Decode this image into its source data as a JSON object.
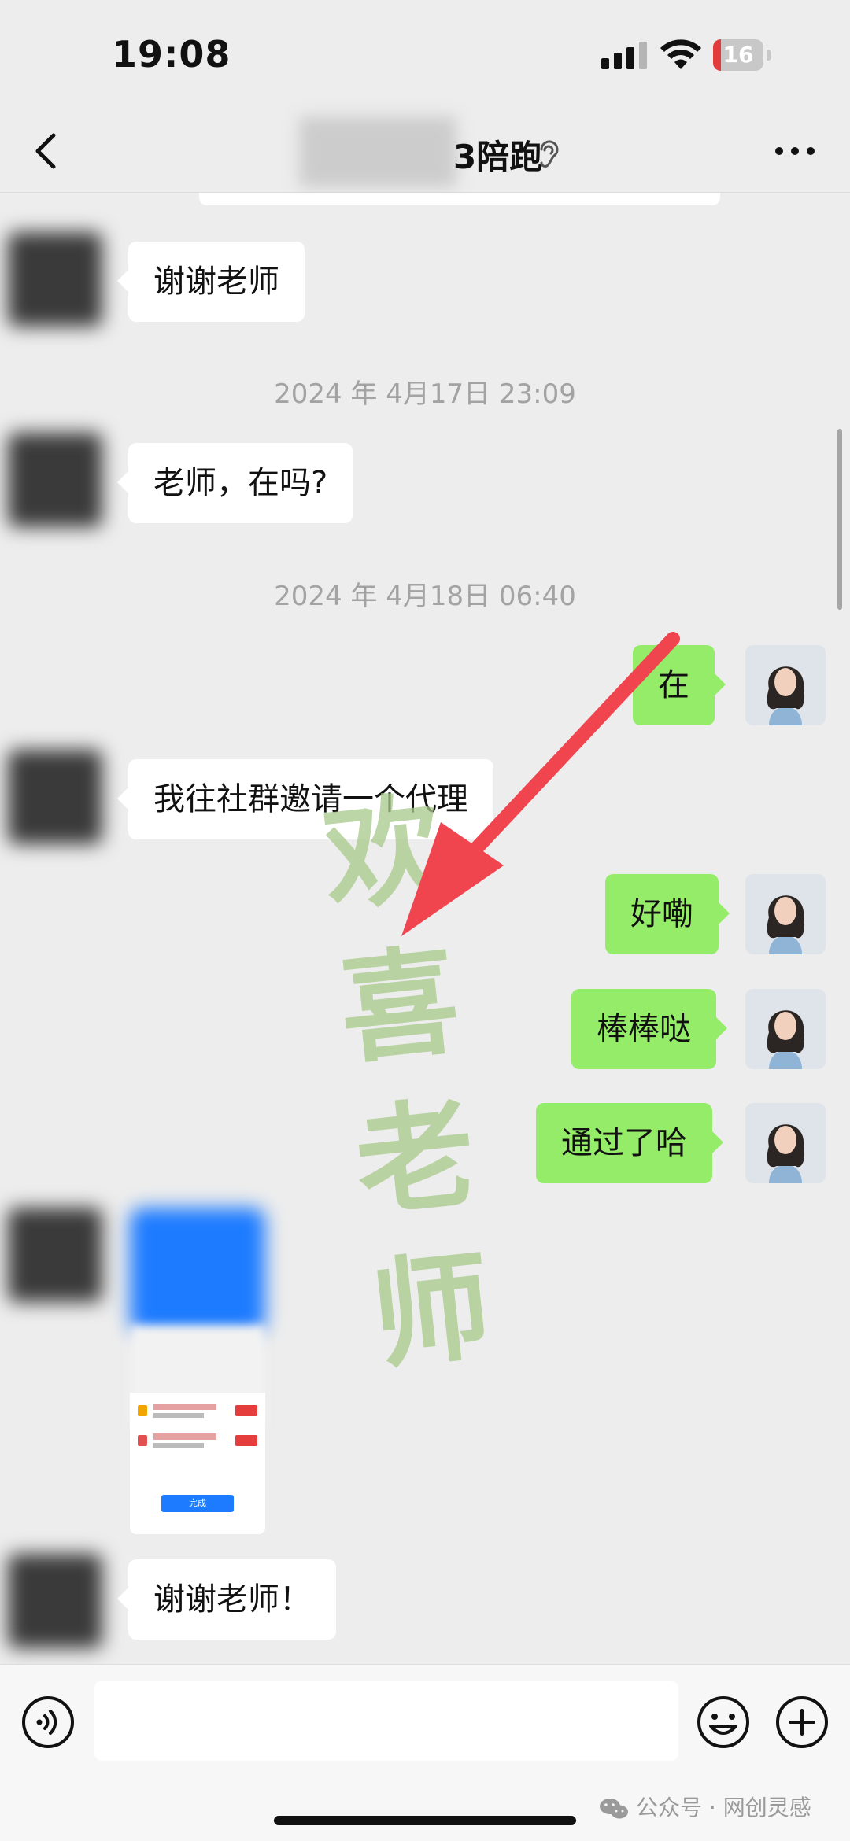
{
  "status_bar": {
    "time": "19:08",
    "battery_level": "16",
    "battery_fraction": 0.16
  },
  "header": {
    "title_suffix": "3陪跑",
    "icons": {
      "back": "back-chevron-icon",
      "ear": "ear-icon",
      "more": "more-dots-icon"
    }
  },
  "messages": {
    "m1": "谢谢老师",
    "ts1": "2024 年 4月17日 23:09",
    "m2": "老师，在吗?",
    "ts2": "2024 年 4月18日 06:40",
    "m3": "在",
    "m4": "我往社群邀请一个代理",
    "m5": "好嘞",
    "m6": "棒棒哒",
    "m7": "通过了哈",
    "m8": "谢谢老师！"
  },
  "screenshot_message": {
    "button_label": "完成"
  },
  "watermark": {
    "text": "欢喜老师"
  },
  "input_bar": {
    "placeholder": "",
    "icons": {
      "voice": "voice-icon",
      "emoji": "emoji-icon",
      "plus": "plus-icon"
    }
  },
  "footer": {
    "text": "公众号 · 网创灵感"
  },
  "colors": {
    "background": "#ededed",
    "outgoing_bubble": "#95ec69",
    "incoming_bubble": "#ffffff",
    "arrow": "#f0444f",
    "watermark": "#a8c98a"
  }
}
